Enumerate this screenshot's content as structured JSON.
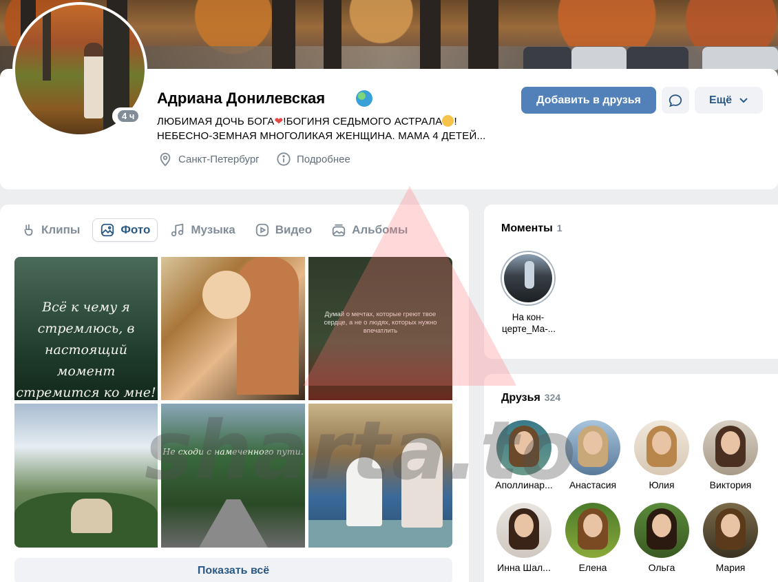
{
  "profile": {
    "name": "Адриана Донилевская",
    "status_line_1": "ЛЮБИМАЯ ДОЧЬ БОГА",
    "status_line_1b": "!БОГИНЯ СЕДЬМОГО АСТРАЛА",
    "status_line_1c": "!",
    "status_line_2": "НЕБЕСНО-ЗЕМНАЯ МНОГОЛИКАЯ ЖЕНЩИНА. МАМА 4 ДЕТЕЙ...",
    "story_age": "4 ч",
    "city": "Санкт-Петербург",
    "more_info": "Подробнее"
  },
  "actions": {
    "add_friend": "Добавить в друзья",
    "more": "Ещё"
  },
  "media_tabs": [
    {
      "label": "Клипы",
      "icon": "clips-icon",
      "active": false
    },
    {
      "label": "Фото",
      "icon": "photo-icon",
      "active": true
    },
    {
      "label": "Музыка",
      "icon": "music-icon",
      "active": false
    },
    {
      "label": "Видео",
      "icon": "video-icon",
      "active": false
    },
    {
      "label": "Альбомы",
      "icon": "albums-icon",
      "active": false
    }
  ],
  "photos": {
    "p1_caption": "Всё к чему я стремлюсь, в настоящий момент стремится ко мне!",
    "p3_caption": "Думай о мечтах, которые греют твое сердце, а не о людях, которых нужно впечатлить",
    "p5_caption": "Не сходи с намеченного пути."
  },
  "show_all": "Показать всё",
  "moments": {
    "title": "Моменты",
    "count": "1",
    "items": [
      {
        "label": "На кон-церте_Ма-..."
      }
    ]
  },
  "friends": {
    "title": "Друзья",
    "count": "324",
    "items": [
      {
        "name": "Аполлинар..."
      },
      {
        "name": "Анастасия"
      },
      {
        "name": "Юлия"
      },
      {
        "name": "Виктория"
      },
      {
        "name": "Инна Шал..."
      },
      {
        "name": "Елена"
      },
      {
        "name": "Ольга"
      },
      {
        "name": "Мария"
      }
    ]
  },
  "watermark": "sharta.to",
  "colors": {
    "accent": "#5181b8",
    "link": "#2a5885",
    "secondary_text": "#818c99",
    "page_bg": "#edeef0"
  }
}
